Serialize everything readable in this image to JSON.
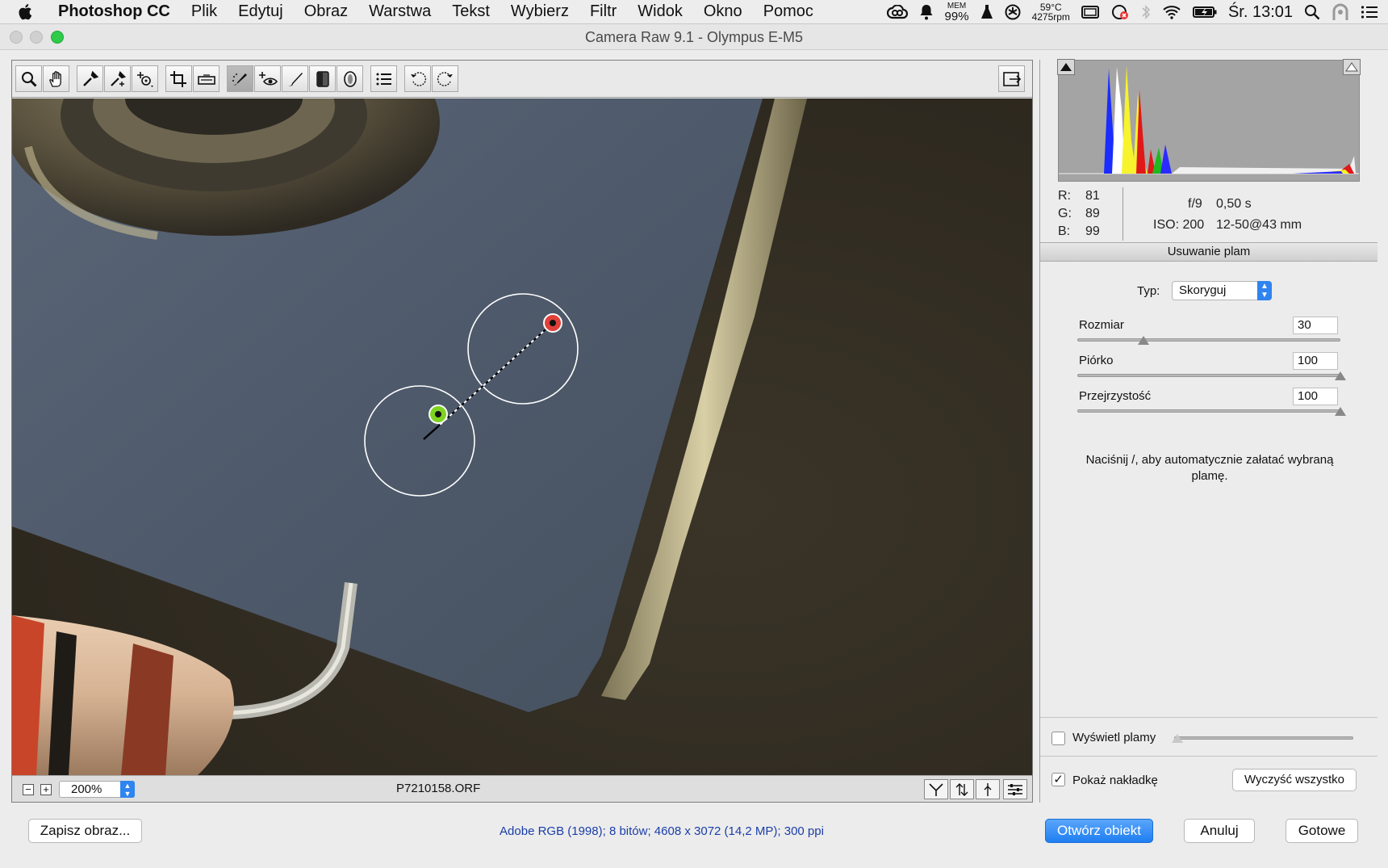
{
  "menubar": {
    "app_name": "Photoshop CC",
    "items": [
      "Plik",
      "Edytuj",
      "Obraz",
      "Warstwa",
      "Tekst",
      "Wybierz",
      "Filtr",
      "Widok",
      "Okno",
      "Pomoc"
    ],
    "status": {
      "mem_label": "MEM",
      "mem_value": "99%",
      "temp": "59°C",
      "rpm": "4275rpm",
      "clock": "Śr. 13:01"
    }
  },
  "window": {
    "title": "Camera Raw 9.1  -  Olympus E-M5"
  },
  "preview": {
    "zoom": "200%",
    "filename": "P7210158.ORF"
  },
  "info": {
    "r_label": "R:",
    "r_value": "81",
    "g_label": "G:",
    "g_value": "89",
    "b_label": "B:",
    "b_value": "99",
    "aperture": "f/9",
    "shutter": "0,50 s",
    "iso": "ISO: 200",
    "lens": "12-50@43 mm"
  },
  "panel": {
    "title": "Usuwanie plam",
    "type_label": "Typ:",
    "type_value": "Skoryguj",
    "size_label": "Rozmiar",
    "size_value": "30",
    "size_fraction": 0.25,
    "feather_label": "Piórko",
    "feather_value": "100",
    "feather_fraction": 1.0,
    "opacity_label": "Przejrzystość",
    "opacity_value": "100",
    "opacity_fraction": 1.0,
    "hint": "Naciśnij /, aby automatycznie załatać wybraną plamę.",
    "show_spots_label": "Wyświetl plamy",
    "show_spots_checked": false,
    "show_overlay_label": "Pokaż nakładkę",
    "show_overlay_checked": true,
    "clear_all_label": "Wyczyść wszystko"
  },
  "footer": {
    "save_label": "Zapisz obraz...",
    "workflow_text": "Adobe RGB (1998); 8 bitów; 4608 x 3072 (14,2 MP); 300 ppi",
    "open_object_label": "Otwórz obiekt",
    "cancel_label": "Anuluj",
    "done_label": "Gotowe"
  },
  "colors": {
    "accent": "#1f7ef1",
    "source_spot": "#7ed321",
    "target_spot": "#e0403a"
  }
}
